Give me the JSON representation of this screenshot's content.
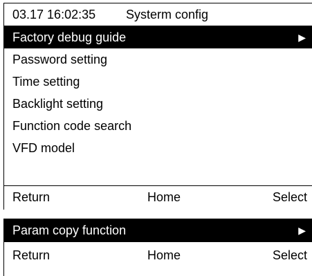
{
  "main_panel": {
    "header": {
      "datetime": "03.17 16:02:35",
      "title": "Systerm config"
    },
    "menu_items": [
      {
        "label": "Factory debug guide",
        "selected": true,
        "arrow": "▶"
      },
      {
        "label": "Password setting",
        "selected": false
      },
      {
        "label": "Time setting",
        "selected": false
      },
      {
        "label": "Backlight setting",
        "selected": false
      },
      {
        "label": "Function code search",
        "selected": false
      },
      {
        "label": "VFD model",
        "selected": false
      }
    ],
    "softkeys": {
      "left": "Return",
      "middle": "Home",
      "right": "Select"
    }
  },
  "secondary_panel": {
    "menu_items": [
      {
        "label": "Param copy function",
        "selected": true,
        "arrow": "▶"
      }
    ],
    "softkeys": {
      "left": "Return",
      "middle": "Home",
      "right": "Select"
    }
  },
  "colors": {
    "selected_bg": "#000000",
    "selected_fg": "#ffffff",
    "background": "#ffffff",
    "text": "#000000"
  }
}
